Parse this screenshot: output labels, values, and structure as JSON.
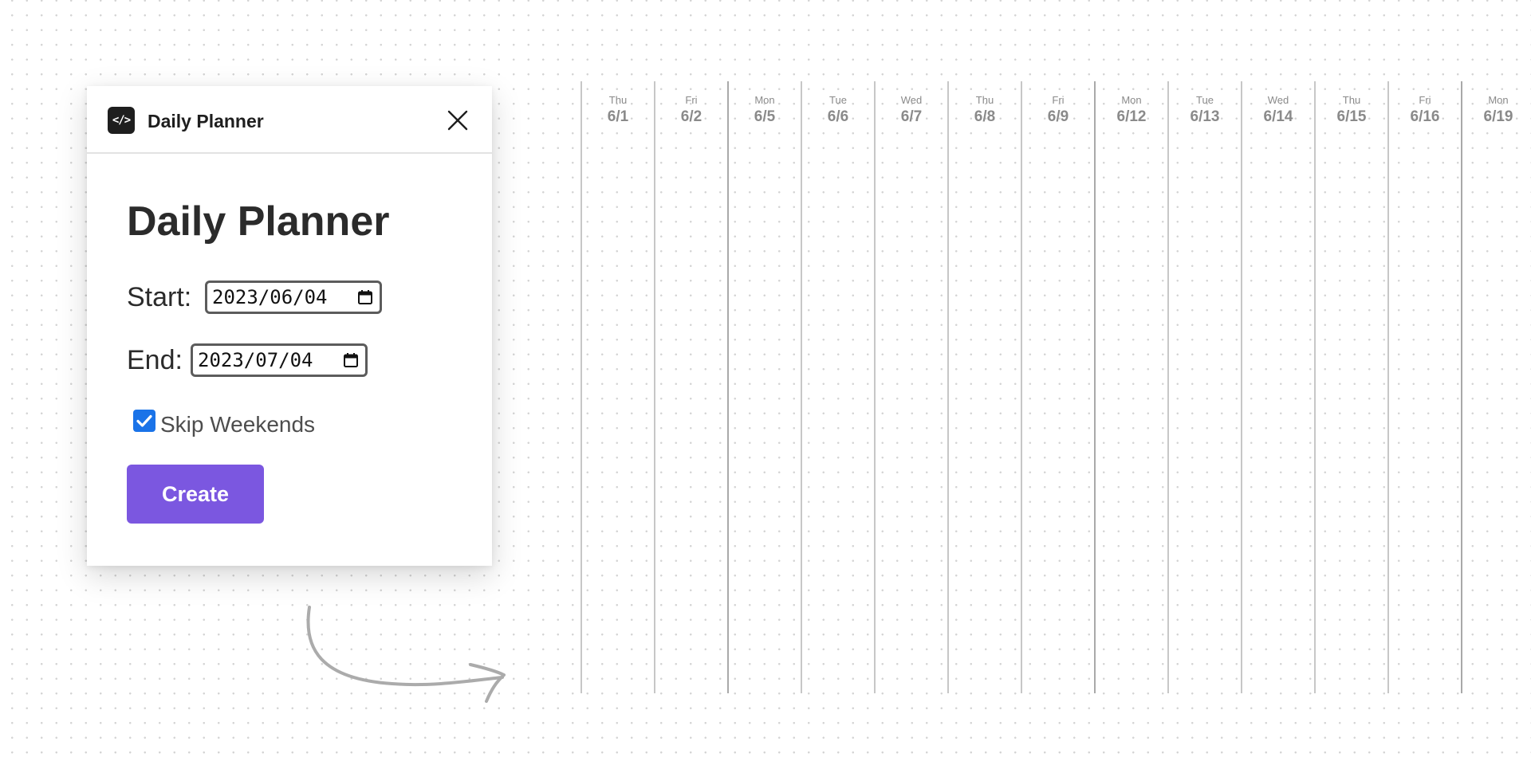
{
  "window": {
    "title": "Daily Planner",
    "icon": "code-icon",
    "icon_glyph": "</>",
    "close_icon": "close-icon"
  },
  "form": {
    "heading": "Daily Planner",
    "start_label": "Start:",
    "start_value": "2023/06/04",
    "end_label": "End:",
    "end_value": "2023/07/04",
    "skip_weekends_label": "Skip Weekends",
    "skip_weekends_checked": true,
    "create_label": "Create"
  },
  "calendar": {
    "columns": [
      {
        "dow": "Thu",
        "date": "6/1"
      },
      {
        "dow": "Fri",
        "date": "6/2"
      },
      {
        "dow": "Mon",
        "date": "6/5"
      },
      {
        "dow": "Tue",
        "date": "6/6"
      },
      {
        "dow": "Wed",
        "date": "6/7"
      },
      {
        "dow": "Thu",
        "date": "6/8"
      },
      {
        "dow": "Fri",
        "date": "6/9"
      },
      {
        "dow": "Mon",
        "date": "6/12"
      },
      {
        "dow": "Tue",
        "date": "6/13"
      },
      {
        "dow": "Wed",
        "date": "6/14"
      },
      {
        "dow": "Thu",
        "date": "6/15"
      },
      {
        "dow": "Fri",
        "date": "6/16"
      },
      {
        "dow": "Mon",
        "date": "6/19"
      }
    ]
  },
  "colors": {
    "accent": "#7b57e0",
    "checkbox": "#1a73e8",
    "canvas_dot": "#d4d4d4",
    "column_line": "#c7c7c7",
    "column_text": "#8a8a8a"
  },
  "decorations": {
    "arrow": "curved-arrow-icon"
  }
}
